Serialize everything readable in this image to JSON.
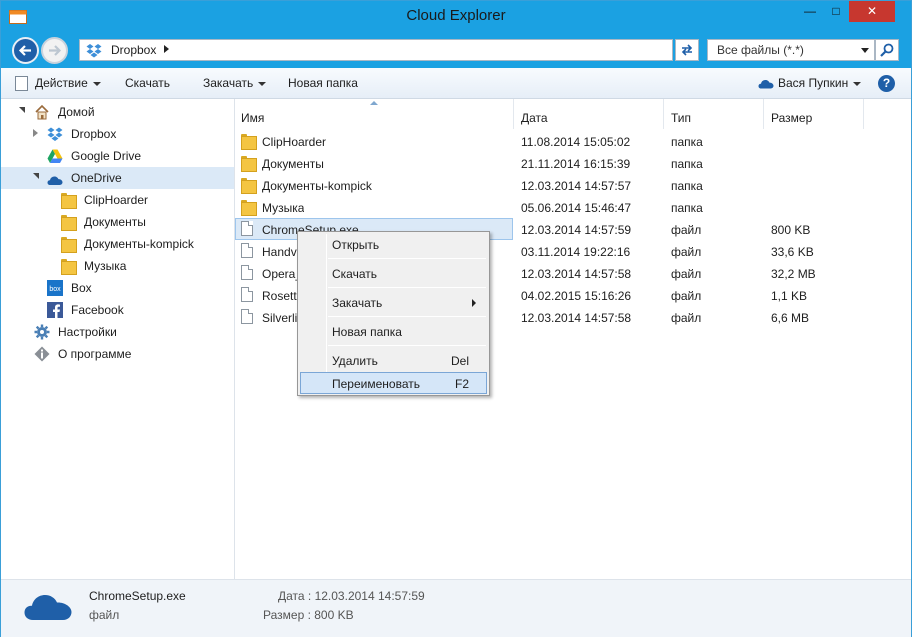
{
  "window": {
    "title": "Cloud Explorer",
    "minimize_glyph": "—",
    "maximize_glyph": "□",
    "close_glyph": "✕"
  },
  "address": {
    "crumb": "Dropbox",
    "filter_value": "Все файлы (*.*)"
  },
  "toolbar": {
    "action_label": "Действие",
    "download_label": "Скачать",
    "upload_label": "Закачать",
    "new_folder_label": "Новая папка",
    "user_label": "Вася Пупкин",
    "help_glyph": "?"
  },
  "sidebar": {
    "items": [
      {
        "label": "Домой",
        "icon": "home-icon"
      },
      {
        "label": "Dropbox",
        "icon": "dropbox-icon"
      },
      {
        "label": "Google Drive",
        "icon": "google-drive-icon"
      },
      {
        "label": "OneDrive",
        "icon": "onedrive-icon"
      },
      {
        "label": "ClipHoarder",
        "icon": "folder-icon"
      },
      {
        "label": "Документы",
        "icon": "folder-icon"
      },
      {
        "label": "Документы-kompick",
        "icon": "folder-icon"
      },
      {
        "label": "Музыка",
        "icon": "folder-icon"
      },
      {
        "label": "Box",
        "icon": "box-icon"
      },
      {
        "label": "Facebook",
        "icon": "facebook-icon"
      },
      {
        "label": "Настройки",
        "icon": "gear-icon"
      },
      {
        "label": "О программе",
        "icon": "info-icon"
      }
    ]
  },
  "columns": {
    "name": "Имя",
    "date": "Дата",
    "type": "Тип",
    "size": "Размер"
  },
  "files": [
    {
      "name": "ClipHoarder",
      "date": "11.08.2014 15:05:02",
      "type": "папка",
      "size": "",
      "icon": "folder-icon"
    },
    {
      "name": "Документы",
      "date": "21.11.2014 16:15:39",
      "type": "папка",
      "size": "",
      "icon": "folder-icon"
    },
    {
      "name": "Документы-kompick",
      "date": "12.03.2014 14:57:57",
      "type": "папка",
      "size": "",
      "icon": "folder-icon"
    },
    {
      "name": "Музыка",
      "date": "05.06.2014 15:46:47",
      "type": "папка",
      "size": "",
      "icon": "folder-icon"
    },
    {
      "name": "ChromeSetup.exe",
      "date": "12.03.2014 14:57:59",
      "type": "файл",
      "size": "800 KB",
      "icon": "file-icon"
    },
    {
      "name": "Handv",
      "date": "03.11.2014 19:22:16",
      "type": "файл",
      "size": "33,6 KB",
      "icon": "file-icon"
    },
    {
      "name": "Opera_",
      "date": "12.03.2014 14:57:58",
      "type": "файл",
      "size": "32,2 MB",
      "icon": "file-icon"
    },
    {
      "name": "Rosett",
      "date": "04.02.2015 15:16:26",
      "type": "файл",
      "size": "1,1 KB",
      "icon": "file-icon"
    },
    {
      "name": "Silverli",
      "date": "12.03.2014 14:57:58",
      "type": "файл",
      "size": "6,6 MB",
      "icon": "file-icon"
    }
  ],
  "context_menu": {
    "open": "Открыть",
    "download": "Скачать",
    "upload": "Закачать",
    "new_folder": "Новая папка",
    "delete": "Удалить",
    "delete_key": "Del",
    "rename": "Переименовать",
    "rename_key": "F2"
  },
  "status": {
    "name": "ChromeSetup.exe",
    "type": "файл",
    "date": "Дата : 12.03.2014 14:57:59",
    "size": "Размер : 800 KB"
  },
  "colors": {
    "titlebar": "#1ba1e2",
    "selection": "#dbe9f7",
    "close": "#c7372f"
  }
}
